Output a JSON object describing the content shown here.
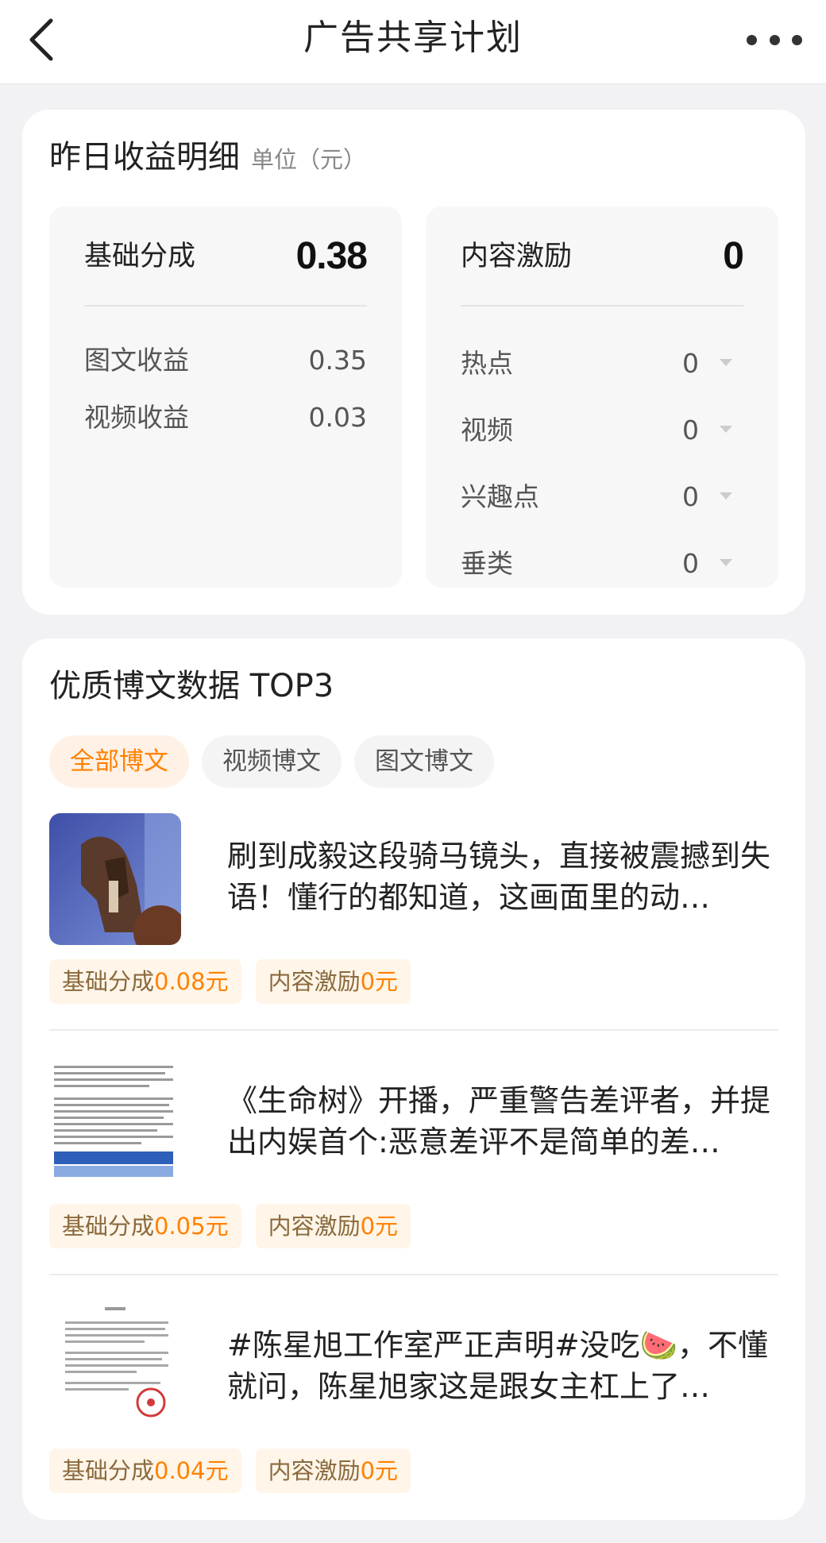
{
  "header": {
    "title": "广告共享计划"
  },
  "earnings": {
    "title": "昨日收益明细",
    "unit": "单位（元）",
    "base": {
      "label": "基础分成",
      "value": "0.38",
      "rows": [
        {
          "label": "图文收益",
          "value": "0.35"
        },
        {
          "label": "视频收益",
          "value": "0.03"
        }
      ]
    },
    "incentive": {
      "label": "内容激励",
      "value": "0",
      "rows": [
        {
          "label": "热点",
          "value": "0"
        },
        {
          "label": "视频",
          "value": "0"
        },
        {
          "label": "兴趣点",
          "value": "0"
        },
        {
          "label": "垂类",
          "value": "0"
        }
      ]
    }
  },
  "top3": {
    "title": "优质博文数据 TOP3",
    "tabs": [
      {
        "label": "全部博文",
        "active": true
      },
      {
        "label": "视频博文",
        "active": false
      },
      {
        "label": "图文博文",
        "active": false
      }
    ],
    "items": [
      {
        "title": "刷到成毅这段骑马镜头，直接被震撼到失语！懂行的都知道，这画面里的动…",
        "base_label": "基础分成",
        "base_value": "0.08元",
        "incentive_label": "内容激励",
        "incentive_value": "0元"
      },
      {
        "title": "《生命树》开播，严重警告差评者，并提出内娱首个:恶意差评不是简单的差…",
        "base_label": "基础分成",
        "base_value": "0.05元",
        "incentive_label": "内容激励",
        "incentive_value": "0元"
      },
      {
        "title": "#陈星旭工作室严正声明#没吃🍉，不懂就问，陈星旭家这是跟女主杠上了…",
        "base_label": "基础分成",
        "base_value": "0.04元",
        "incentive_label": "内容激励",
        "incentive_value": "0元"
      }
    ]
  },
  "colors": {
    "accent": "#ff8200",
    "tag_bg": "#fff5e8",
    "page_bg": "#f2f2f4"
  }
}
